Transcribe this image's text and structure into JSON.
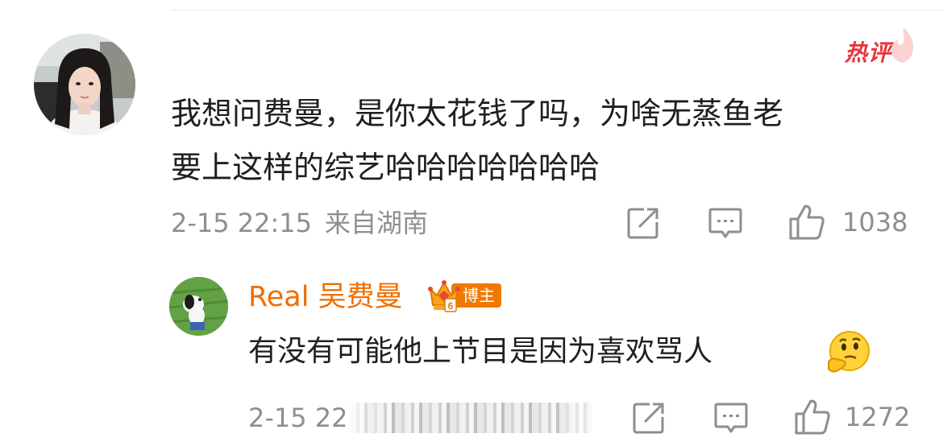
{
  "comment": {
    "badge": "热评",
    "text_line1": "我想问费曼，是你太花钱了吗，为啥无蒸鱼老",
    "text_line2": "要上这样的综艺哈哈哈哈哈哈哈",
    "time": "2-15 22:15",
    "location": "来自湖南",
    "like_count": "1038"
  },
  "reply": {
    "username": "Real 吴费曼",
    "blogger_label": "博主",
    "text": "有没有可能他上节目是因为喜欢骂人",
    "time_partial": "2-15 22",
    "like_count": "1272"
  },
  "icons": {
    "forward": "share-edit-icon",
    "comment": "comment-icon",
    "like": "thumbs-up-icon",
    "emoji": "thinking-face-icon"
  },
  "colors": {
    "username": "#f06e00",
    "hot_badge": "#e8343a",
    "meta_gray": "#8e8e8e"
  }
}
